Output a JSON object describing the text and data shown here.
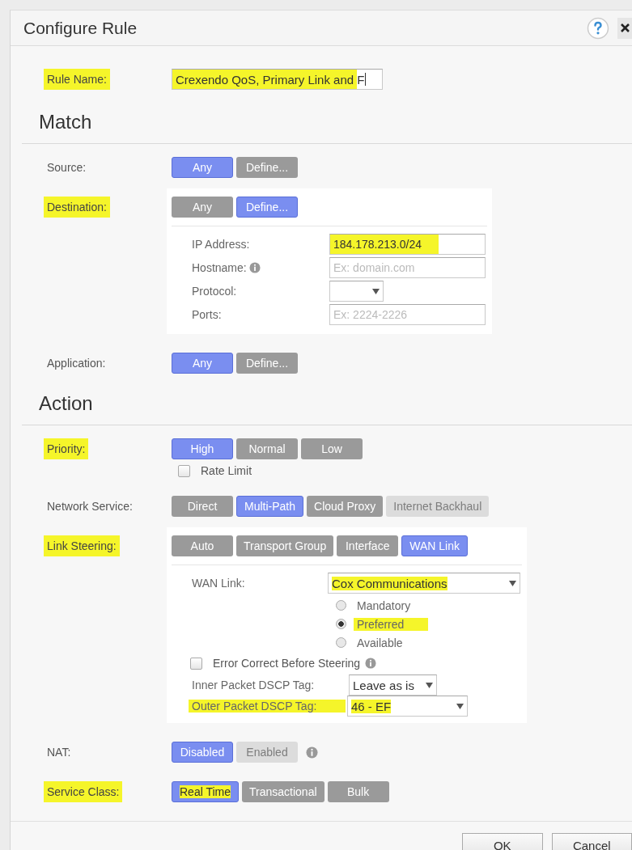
{
  "dialog": {
    "title": "Configure Rule"
  },
  "rule_name": {
    "label": "Rule Name:",
    "value": "Crexendo QoS, Primary Link and F",
    "label_highlighted": true,
    "value_highlighted": true
  },
  "sections": [
    {
      "title": "Match",
      "rows": [
        {
          "kind": "buttons",
          "label": "Source:",
          "highlighted": false,
          "buttons": [
            {
              "label": "Any",
              "selected": true,
              "disabled": false
            },
            {
              "label": "Define...",
              "selected": false,
              "disabled": false
            }
          ]
        },
        {
          "kind": "destination",
          "label": "Destination:",
          "highlighted": true,
          "buttons": [
            {
              "label": "Any",
              "selected": false,
              "disabled": false
            },
            {
              "label": "Define...",
              "selected": true,
              "disabled": false
            }
          ],
          "fields": [
            {
              "kind": "text",
              "label": "IP Address:",
              "value": "184.178.213.0/24",
              "highlighted": true,
              "info": false
            },
            {
              "kind": "text",
              "label": "Hostname:",
              "placeholder": "Ex: domain.com",
              "highlighted": false,
              "info": true
            },
            {
              "kind": "select",
              "label": "Protocol:",
              "highlighted": false,
              "info": false
            },
            {
              "kind": "text",
              "label": "Ports:",
              "placeholder": "Ex: 2224-2226",
              "highlighted": false,
              "info": false
            }
          ]
        },
        {
          "kind": "buttons",
          "label": "Application:",
          "highlighted": false,
          "buttons": [
            {
              "label": "Any",
              "selected": true,
              "disabled": false
            },
            {
              "label": "Define...",
              "selected": false,
              "disabled": false
            }
          ]
        }
      ]
    },
    {
      "title": "Action",
      "rows": [
        {
          "kind": "buttons",
          "label": "Priority:",
          "highlighted": true,
          "buttons": [
            {
              "label": "High",
              "selected": true,
              "disabled": false
            },
            {
              "label": "Normal",
              "selected": false,
              "disabled": false
            },
            {
              "label": "Low",
              "selected": false,
              "disabled": false
            }
          ],
          "checkbox": {
            "label": "Rate Limit",
            "checked": false
          }
        },
        {
          "kind": "buttons",
          "label": "Network Service:",
          "highlighted": false,
          "buttons": [
            {
              "label": "Direct",
              "selected": false,
              "disabled": false
            },
            {
              "label": "Multi-Path",
              "selected": true,
              "disabled": false
            },
            {
              "label": "Cloud Proxy",
              "selected": false,
              "disabled": false
            },
            {
              "label": "Internet Backhaul",
              "selected": false,
              "disabled": true
            }
          ]
        },
        {
          "kind": "link_steering",
          "label": "Link Steering:",
          "highlighted": true,
          "buttons": [
            {
              "label": "Auto",
              "selected": false,
              "disabled": false
            },
            {
              "label": "Transport Group",
              "selected": false,
              "disabled": false
            },
            {
              "label": "Interface",
              "selected": false,
              "disabled": false
            },
            {
              "label": "WAN Link",
              "selected": true,
              "disabled": false
            }
          ],
          "wan_link": {
            "label": "WAN Link:",
            "value": "Cox Communications",
            "highlighted": true
          },
          "radios": [
            {
              "label": "Mandatory",
              "selected": false,
              "highlighted": false
            },
            {
              "label": "Preferred",
              "selected": true,
              "highlighted": true
            },
            {
              "label": "Available",
              "selected": false,
              "highlighted": false
            }
          ],
          "checkbox": {
            "label": "Error Correct Before Steering",
            "checked": false,
            "info": true
          },
          "dscp": [
            {
              "label": "Inner Packet DSCP Tag:",
              "value": "Leave as is",
              "label_highlighted": false,
              "value_highlighted": false,
              "wide": false
            },
            {
              "label": "Outer Packet DSCP Tag:",
              "value": "46 - EF",
              "label_highlighted": true,
              "value_highlighted": true,
              "wide": true
            }
          ]
        },
        {
          "kind": "buttons",
          "label": "NAT:",
          "highlighted": false,
          "info": true,
          "buttons": [
            {
              "label": "Disabled",
              "selected": true,
              "disabled": false
            },
            {
              "label": "Enabled",
              "selected": false,
              "disabled": true
            }
          ]
        },
        {
          "kind": "buttons",
          "label": "Service Class:",
          "highlighted": true,
          "buttons": [
            {
              "label": "Real Time",
              "selected": true,
              "disabled": false,
              "highlighted": true
            },
            {
              "label": "Transactional",
              "selected": false,
              "disabled": false,
              "highlighted": false
            },
            {
              "label": "Bulk",
              "selected": false,
              "disabled": false,
              "highlighted": false
            }
          ]
        }
      ]
    }
  ],
  "footer": {
    "buttons": [
      "OK",
      "Cancel"
    ]
  }
}
